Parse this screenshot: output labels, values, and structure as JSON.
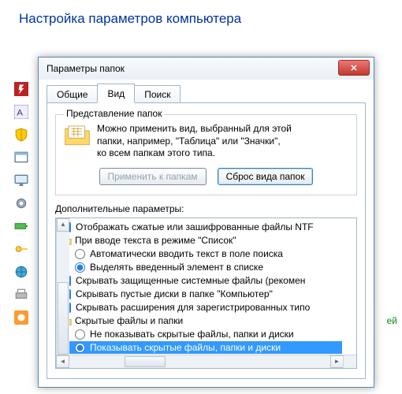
{
  "header": {
    "title": "Настройка параметров компьютера"
  },
  "dialog": {
    "title": "Параметры папок",
    "tabs": {
      "general": "Общие",
      "view": "Вид",
      "search": "Поиск"
    },
    "view_group": {
      "title": "Представление папок",
      "text_line1": "Можно применить вид, выбранный для этой",
      "text_line2": "папки, например, \"Таблица\" или \"Значки\",",
      "text_line3": "ко всем папкам этого типа.",
      "apply_btn": "Применить к папкам",
      "reset_btn": "Сброс вида папок"
    },
    "advanced_label": "Дополнительные параметры:",
    "items": [
      {
        "type": "check",
        "checked": true,
        "indent": 0,
        "label": "Отображать сжатые или зашифрованные файлы NTF"
      },
      {
        "type": "folder",
        "indent": 0,
        "label": "При вводе текста в режиме \"Список\""
      },
      {
        "type": "radio",
        "checked": false,
        "indent": 1,
        "label": "Автоматически вводить текст в поле поиска"
      },
      {
        "type": "radio",
        "checked": true,
        "indent": 1,
        "label": "Выделять введенный элемент в списке"
      },
      {
        "type": "check",
        "checked": true,
        "indent": 0,
        "label": "Скрывать защищенные системные файлы (рекомен"
      },
      {
        "type": "check",
        "checked": true,
        "indent": 0,
        "label": "Скрывать пустые диски в папке \"Компьютер\""
      },
      {
        "type": "check",
        "checked": true,
        "indent": 0,
        "label": "Скрывать расширения для зарегистрированных типо"
      },
      {
        "type": "folder",
        "indent": 0,
        "label": "Скрытые файлы и папки"
      },
      {
        "type": "radio",
        "checked": false,
        "indent": 1,
        "label": "Не показывать скрытые файлы, папки и диски"
      },
      {
        "type": "radio",
        "checked": true,
        "indent": 1,
        "label": "Показывать скрытые файлы, папки и диски",
        "selected": true
      }
    ]
  },
  "side_text": "ей"
}
